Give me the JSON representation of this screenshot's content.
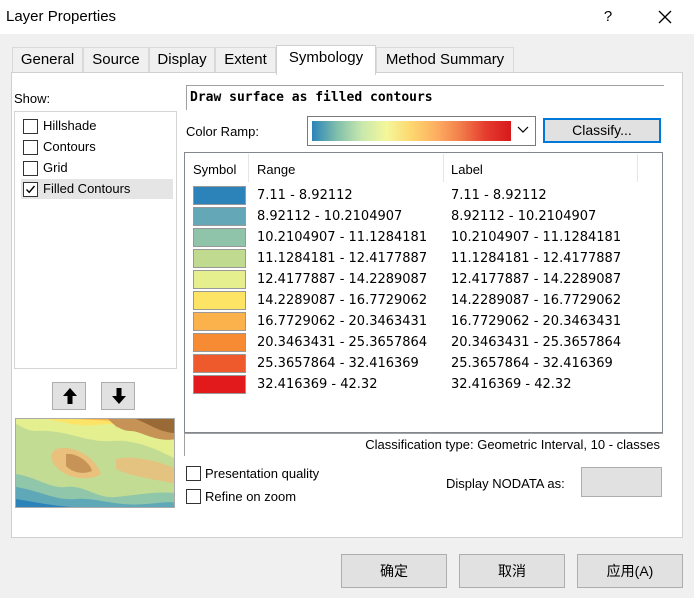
{
  "window": {
    "title": "Layer Properties",
    "help_label": "?",
    "close_icon": "close-icon"
  },
  "tabs": [
    {
      "label": "General"
    },
    {
      "label": "Source"
    },
    {
      "label": "Display"
    },
    {
      "label": "Extent"
    },
    {
      "label": "Symbology",
      "active": true
    },
    {
      "label": "Method Summary"
    }
  ],
  "show": {
    "label": "Show:",
    "items": [
      {
        "label": "Hillshade",
        "checked": false
      },
      {
        "label": "Contours",
        "checked": false
      },
      {
        "label": "Grid",
        "checked": false
      },
      {
        "label": "Filled Contours",
        "checked": true,
        "selected": true
      }
    ],
    "move_up_icon": "arrow-up-icon",
    "move_down_icon": "arrow-down-icon"
  },
  "symbology": {
    "description": "Draw surface as filled contours",
    "color_ramp_label": "Color Ramp:",
    "classify_label": "Classify...",
    "columns": {
      "symbol": "Symbol",
      "range": "Range",
      "label": "Label"
    },
    "classes": [
      {
        "color": "#2b83ba",
        "range": "7.11 - 8.92112",
        "label": "7.11 - 8.92112"
      },
      {
        "color": "#64a8b8",
        "range": "8.92112 - 10.2104907",
        "label": "8.92112 - 10.2104907"
      },
      {
        "color": "#90c4aa",
        "range": "10.2104907 - 11.1284181",
        "label": "10.2104907 - 11.1284181"
      },
      {
        "color": "#c0db8f",
        "range": "11.1284181 - 12.4177887",
        "label": "11.1284181 - 12.4177887"
      },
      {
        "color": "#e6ef8d",
        "range": "12.4177887 - 14.2289087",
        "label": "12.4177887 - 14.2289087"
      },
      {
        "color": "#fde465",
        "range": "14.2289087 - 16.7729062",
        "label": "14.2289087 - 16.7729062"
      },
      {
        "color": "#fbb24d",
        "range": "16.7729062 - 20.3463431",
        "label": "16.7729062 - 20.3463431"
      },
      {
        "color": "#f78b34",
        "range": "20.3463431 - 25.3657864",
        "label": "20.3463431 - 25.3657864"
      },
      {
        "color": "#ef5a2c",
        "range": "25.3657864 - 32.416369",
        "label": "25.3657864 - 32.416369"
      },
      {
        "color": "#e31a1c",
        "range": "32.416369 - 42.32",
        "label": "32.416369 - 42.32"
      }
    ],
    "classification_info": "Classification type: Geometric Interval,   10 - classes",
    "presentation_quality": {
      "label": "Presentation quality",
      "checked": false
    },
    "refine_on_zoom": {
      "label": "Refine on zoom",
      "checked": false
    },
    "nodata_label": "Display NODATA as:"
  },
  "footer": {
    "ok_label": "确定",
    "cancel_label": "取消",
    "apply_label": "应用(A)"
  }
}
